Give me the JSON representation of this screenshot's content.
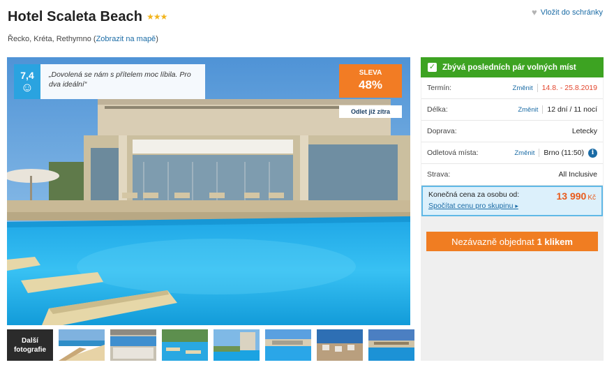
{
  "hotel": {
    "name": "Hotel Scaleta Beach",
    "stars": "★★★",
    "location_text": "Řecko, Kréta, Rethymno",
    "map_link": "Zobrazit na mapě"
  },
  "wishlist": {
    "label": "Vložit do schránky",
    "icon": "heart-icon"
  },
  "rating": {
    "score": "7,4",
    "icon": "smiley-icon",
    "quote": "„Dovolená se nám s přítelem moc líbila. Pro dva ideální“"
  },
  "discount": {
    "label": "SLEVA",
    "percent": "48%"
  },
  "departure_tag": "Odlet již zítra",
  "thumbnails": {
    "more_label_1": "Další",
    "more_label_2": "fotografie"
  },
  "availability": "Zbývá posledních pár volných míst",
  "details": {
    "term": {
      "label": "Termín:",
      "change": "Změnit",
      "value": "14.8. - 25.8.2019"
    },
    "length": {
      "label": "Délka:",
      "change": "Změnit",
      "value": "12 dní / 11 nocí"
    },
    "transport": {
      "label": "Doprava:",
      "value": "Letecky"
    },
    "departure": {
      "label": "Odletová místa:",
      "change": "Změnit",
      "value": "Brno  (11:50)"
    },
    "board": {
      "label": "Strava:",
      "value": "All Inclusive"
    }
  },
  "price": {
    "label": "Konečná cena za osobu od:",
    "amount": "13 990",
    "currency": "Kč",
    "group_link": "Spočítat cenu pro skupinu"
  },
  "order": {
    "label": "Nezávazně objednat",
    "label_bold": "1 klikem"
  },
  "colors": {
    "accent_orange": "#f07d22",
    "green": "#3da322",
    "link_blue": "#1a6ba5",
    "rating_blue": "#2aa3e0"
  }
}
